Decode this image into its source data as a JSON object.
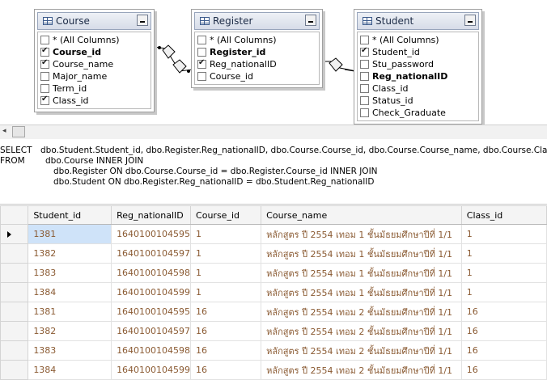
{
  "tables": [
    {
      "title": "Course",
      "columns": [
        {
          "label": "* (All Columns)",
          "checked": false,
          "key": false
        },
        {
          "label": "Course_id",
          "checked": true,
          "key": true
        },
        {
          "label": "Course_name",
          "checked": true,
          "key": false
        },
        {
          "label": "Major_name",
          "checked": false,
          "key": false
        },
        {
          "label": "Term_id",
          "checked": false,
          "key": false
        },
        {
          "label": "Class_id",
          "checked": true,
          "key": false
        }
      ]
    },
    {
      "title": "Register",
      "columns": [
        {
          "label": "* (All Columns)",
          "checked": false,
          "key": false
        },
        {
          "label": "Register_id",
          "checked": false,
          "key": true
        },
        {
          "label": "Reg_nationalID",
          "checked": true,
          "key": false
        },
        {
          "label": "Course_id",
          "checked": false,
          "key": false
        }
      ]
    },
    {
      "title": "Student",
      "columns": [
        {
          "label": "* (All Columns)",
          "checked": false,
          "key": false
        },
        {
          "label": "Student_id",
          "checked": true,
          "key": false
        },
        {
          "label": "Stu_password",
          "checked": false,
          "key": false
        },
        {
          "label": "Reg_nationalID",
          "checked": false,
          "key": true
        },
        {
          "label": "Class_id",
          "checked": false,
          "key": false
        },
        {
          "label": "Status_id",
          "checked": false,
          "key": false
        },
        {
          "label": "Check_Graduate",
          "checked": false,
          "key": false
        }
      ]
    }
  ],
  "scroll_left_glyph": "◂",
  "sql": {
    "select_kw": "SELECT",
    "select_cols": "dbo.Student.Student_id, dbo.Register.Reg_nationalID, dbo.Course.Course_id, dbo.Course.Course_name, dbo.Course.Class_id",
    "from_kw": "FROM",
    "from_1": "dbo.Course INNER JOIN",
    "from_2": "dbo.Register ON dbo.Course.Course_id = dbo.Register.Course_id INNER JOIN",
    "from_3": "dbo.Student ON dbo.Register.Reg_nationalID = dbo.Student.Reg_nationalID"
  },
  "grid": {
    "headers": [
      "Student_id",
      "Reg_nationalID",
      "Course_id",
      "Course_name",
      "Class_id"
    ],
    "rows": [
      [
        "1381",
        "1640100104595",
        "1",
        "หลักสูตร ปี 2554 เทอม 1 ชั้นมัธยมศึกษาปีที่ 1/1",
        "1"
      ],
      [
        "1382",
        "1640100104597",
        "1",
        "หลักสูตร ปี 2554 เทอม 1 ชั้นมัธยมศึกษาปีที่ 1/1",
        "1"
      ],
      [
        "1383",
        "1640100104598",
        "1",
        "หลักสูตร ปี 2554 เทอม 1 ชั้นมัธยมศึกษาปีที่ 1/1",
        "1"
      ],
      [
        "1384",
        "1640100104599",
        "1",
        "หลักสูตร ปี 2554 เทอม 1 ชั้นมัธยมศึกษาปีที่ 1/1",
        "1"
      ],
      [
        "1381",
        "1640100104595",
        "16",
        "หลักสูตร ปี 2554 เทอม 2 ชั้นมัธยมศึกษาปีที่ 1/1",
        "16"
      ],
      [
        "1382",
        "1640100104597",
        "16",
        "หลักสูตร ปี 2554 เทอม 2 ชั้นมัธยมศึกษาปีที่ 1/1",
        "16"
      ],
      [
        "1383",
        "1640100104598",
        "16",
        "หลักสูตร ปี 2554 เทอม 2 ชั้นมัธยมศึกษาปีที่ 1/1",
        "16"
      ],
      [
        "1384",
        "1640100104599",
        "16",
        "หลักสูตร ปี 2554 เทอม 2 ชั้นมัธยมศึกษาปีที่ 1/1",
        "16"
      ]
    ]
  },
  "colors": {
    "cell_text": "#8a5a32",
    "selected_cell": "#cfe3f9",
    "header_bg": "#f4f4f4"
  }
}
